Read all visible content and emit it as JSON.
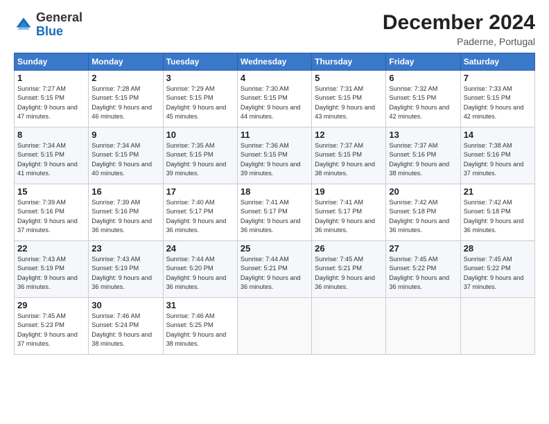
{
  "header": {
    "logo_general": "General",
    "logo_blue": "Blue",
    "month_title": "December 2024",
    "location": "Paderne, Portugal"
  },
  "days_of_week": [
    "Sunday",
    "Monday",
    "Tuesday",
    "Wednesday",
    "Thursday",
    "Friday",
    "Saturday"
  ],
  "weeks": [
    [
      {
        "day": 1,
        "info": "Sunrise: 7:27 AM\nSunset: 5:15 PM\nDaylight: 9 hours and 47 minutes."
      },
      {
        "day": 2,
        "info": "Sunrise: 7:28 AM\nSunset: 5:15 PM\nDaylight: 9 hours and 46 minutes."
      },
      {
        "day": 3,
        "info": "Sunrise: 7:29 AM\nSunset: 5:15 PM\nDaylight: 9 hours and 45 minutes."
      },
      {
        "day": 4,
        "info": "Sunrise: 7:30 AM\nSunset: 5:15 PM\nDaylight: 9 hours and 44 minutes."
      },
      {
        "day": 5,
        "info": "Sunrise: 7:31 AM\nSunset: 5:15 PM\nDaylight: 9 hours and 43 minutes."
      },
      {
        "day": 6,
        "info": "Sunrise: 7:32 AM\nSunset: 5:15 PM\nDaylight: 9 hours and 42 minutes."
      },
      {
        "day": 7,
        "info": "Sunrise: 7:33 AM\nSunset: 5:15 PM\nDaylight: 9 hours and 42 minutes."
      }
    ],
    [
      {
        "day": 8,
        "info": "Sunrise: 7:34 AM\nSunset: 5:15 PM\nDaylight: 9 hours and 41 minutes."
      },
      {
        "day": 9,
        "info": "Sunrise: 7:34 AM\nSunset: 5:15 PM\nDaylight: 9 hours and 40 minutes."
      },
      {
        "day": 10,
        "info": "Sunrise: 7:35 AM\nSunset: 5:15 PM\nDaylight: 9 hours and 39 minutes."
      },
      {
        "day": 11,
        "info": "Sunrise: 7:36 AM\nSunset: 5:15 PM\nDaylight: 9 hours and 39 minutes."
      },
      {
        "day": 12,
        "info": "Sunrise: 7:37 AM\nSunset: 5:15 PM\nDaylight: 9 hours and 38 minutes."
      },
      {
        "day": 13,
        "info": "Sunrise: 7:37 AM\nSunset: 5:16 PM\nDaylight: 9 hours and 38 minutes."
      },
      {
        "day": 14,
        "info": "Sunrise: 7:38 AM\nSunset: 5:16 PM\nDaylight: 9 hours and 37 minutes."
      }
    ],
    [
      {
        "day": 15,
        "info": "Sunrise: 7:39 AM\nSunset: 5:16 PM\nDaylight: 9 hours and 37 minutes."
      },
      {
        "day": 16,
        "info": "Sunrise: 7:39 AM\nSunset: 5:16 PM\nDaylight: 9 hours and 36 minutes."
      },
      {
        "day": 17,
        "info": "Sunrise: 7:40 AM\nSunset: 5:17 PM\nDaylight: 9 hours and 36 minutes."
      },
      {
        "day": 18,
        "info": "Sunrise: 7:41 AM\nSunset: 5:17 PM\nDaylight: 9 hours and 36 minutes."
      },
      {
        "day": 19,
        "info": "Sunrise: 7:41 AM\nSunset: 5:17 PM\nDaylight: 9 hours and 36 minutes."
      },
      {
        "day": 20,
        "info": "Sunrise: 7:42 AM\nSunset: 5:18 PM\nDaylight: 9 hours and 36 minutes."
      },
      {
        "day": 21,
        "info": "Sunrise: 7:42 AM\nSunset: 5:18 PM\nDaylight: 9 hours and 36 minutes."
      }
    ],
    [
      {
        "day": 22,
        "info": "Sunrise: 7:43 AM\nSunset: 5:19 PM\nDaylight: 9 hours and 36 minutes."
      },
      {
        "day": 23,
        "info": "Sunrise: 7:43 AM\nSunset: 5:19 PM\nDaylight: 9 hours and 36 minutes."
      },
      {
        "day": 24,
        "info": "Sunrise: 7:44 AM\nSunset: 5:20 PM\nDaylight: 9 hours and 36 minutes."
      },
      {
        "day": 25,
        "info": "Sunrise: 7:44 AM\nSunset: 5:21 PM\nDaylight: 9 hours and 36 minutes."
      },
      {
        "day": 26,
        "info": "Sunrise: 7:45 AM\nSunset: 5:21 PM\nDaylight: 9 hours and 36 minutes."
      },
      {
        "day": 27,
        "info": "Sunrise: 7:45 AM\nSunset: 5:22 PM\nDaylight: 9 hours and 36 minutes."
      },
      {
        "day": 28,
        "info": "Sunrise: 7:45 AM\nSunset: 5:22 PM\nDaylight: 9 hours and 37 minutes."
      }
    ],
    [
      {
        "day": 29,
        "info": "Sunrise: 7:45 AM\nSunset: 5:23 PM\nDaylight: 9 hours and 37 minutes."
      },
      {
        "day": 30,
        "info": "Sunrise: 7:46 AM\nSunset: 5:24 PM\nDaylight: 9 hours and 38 minutes."
      },
      {
        "day": 31,
        "info": "Sunrise: 7:46 AM\nSunset: 5:25 PM\nDaylight: 9 hours and 38 minutes."
      },
      null,
      null,
      null,
      null
    ]
  ]
}
